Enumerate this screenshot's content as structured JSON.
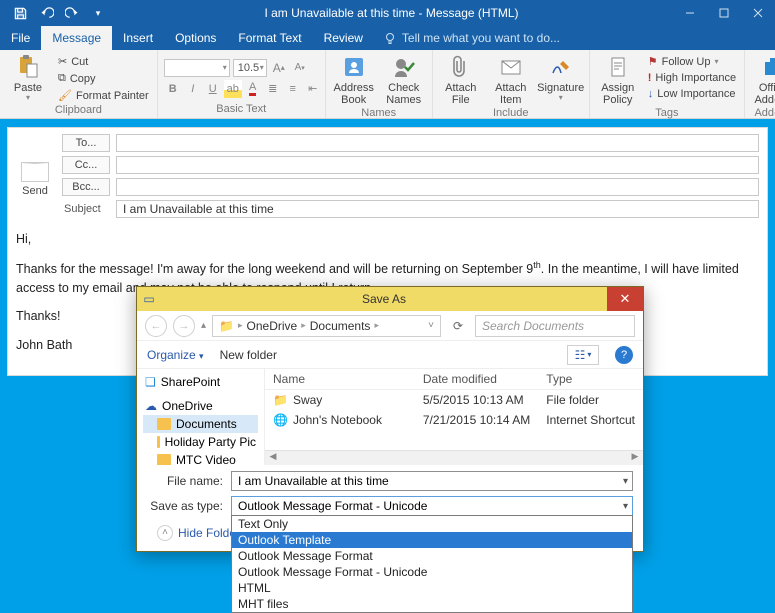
{
  "window": {
    "title": "I am Unavailable at this time - Message (HTML)"
  },
  "tabs": {
    "file": "File",
    "message": "Message",
    "insert": "Insert",
    "options": "Options",
    "formatText": "Format Text",
    "review": "Review",
    "tellMe": "Tell me what you want to do..."
  },
  "ribbon": {
    "clipboard": {
      "paste": "Paste",
      "cut": "Cut",
      "copy": "Copy",
      "formatPainter": "Format Painter",
      "group": "Clipboard"
    },
    "basicText": {
      "font": "",
      "size": "10.5",
      "group": "Basic Text"
    },
    "names": {
      "addressBook": "Address\nBook",
      "checkNames": "Check\nNames",
      "group": "Names"
    },
    "include": {
      "attachFile": "Attach\nFile",
      "attachItem": "Attach\nItem",
      "signature": "Signature",
      "group": "Include"
    },
    "tags": {
      "assignPolicy": "Assign\nPolicy",
      "followUp": "Follow Up",
      "high": "High Importance",
      "low": "Low Importance",
      "group": "Tags"
    },
    "addins": {
      "office": "Office\nAdd-ins",
      "group": "Add-ins"
    }
  },
  "compose": {
    "send": "Send",
    "to": "To...",
    "cc": "Cc...",
    "bcc": "Bcc...",
    "subjectLabel": "Subject",
    "subject": "I am Unavailable at this time",
    "body": {
      "greeting": "Hi,",
      "p1a": "Thanks for the message! I'm away for the long weekend and will be returning on September 9",
      "p1sup": "th",
      "p1b": ". In the meantime, I will have limited access to my email and may not be able to respond until I return.",
      "thanks": "Thanks!",
      "sig": "John Bath"
    }
  },
  "saveAs": {
    "title": "Save As",
    "breadcrumb": [
      "OneDrive",
      "Documents"
    ],
    "searchPlaceholder": "Search Documents",
    "organize": "Organize",
    "newFolder": "New folder",
    "columns": {
      "name": "Name",
      "date": "Date modified",
      "type": "Type"
    },
    "tree": {
      "sharepoint": "SharePoint",
      "onedrive": "OneDrive",
      "documents": "Documents",
      "holiday": "Holiday Party Pic",
      "mtc": "MTC Video"
    },
    "rows": [
      {
        "icon": "folder",
        "name": "Sway",
        "date": "5/5/2015 10:13 AM",
        "type": "File folder"
      },
      {
        "icon": "chrome",
        "name": "John's Notebook",
        "date": "7/21/2015 10:14 AM",
        "type": "Internet Shortcut"
      }
    ],
    "fileNameLabel": "File name:",
    "fileName": "I am Unavailable at this time",
    "saveTypeLabel": "Save as type:",
    "saveType": "Outlook Message Format - Unicode",
    "hideFolders": "Hide Folders",
    "typeOptions": [
      "Text Only",
      "Outlook Template",
      "Outlook Message Format",
      "Outlook Message Format - Unicode",
      "HTML",
      "MHT files"
    ],
    "selectedTypeIndex": 1
  }
}
